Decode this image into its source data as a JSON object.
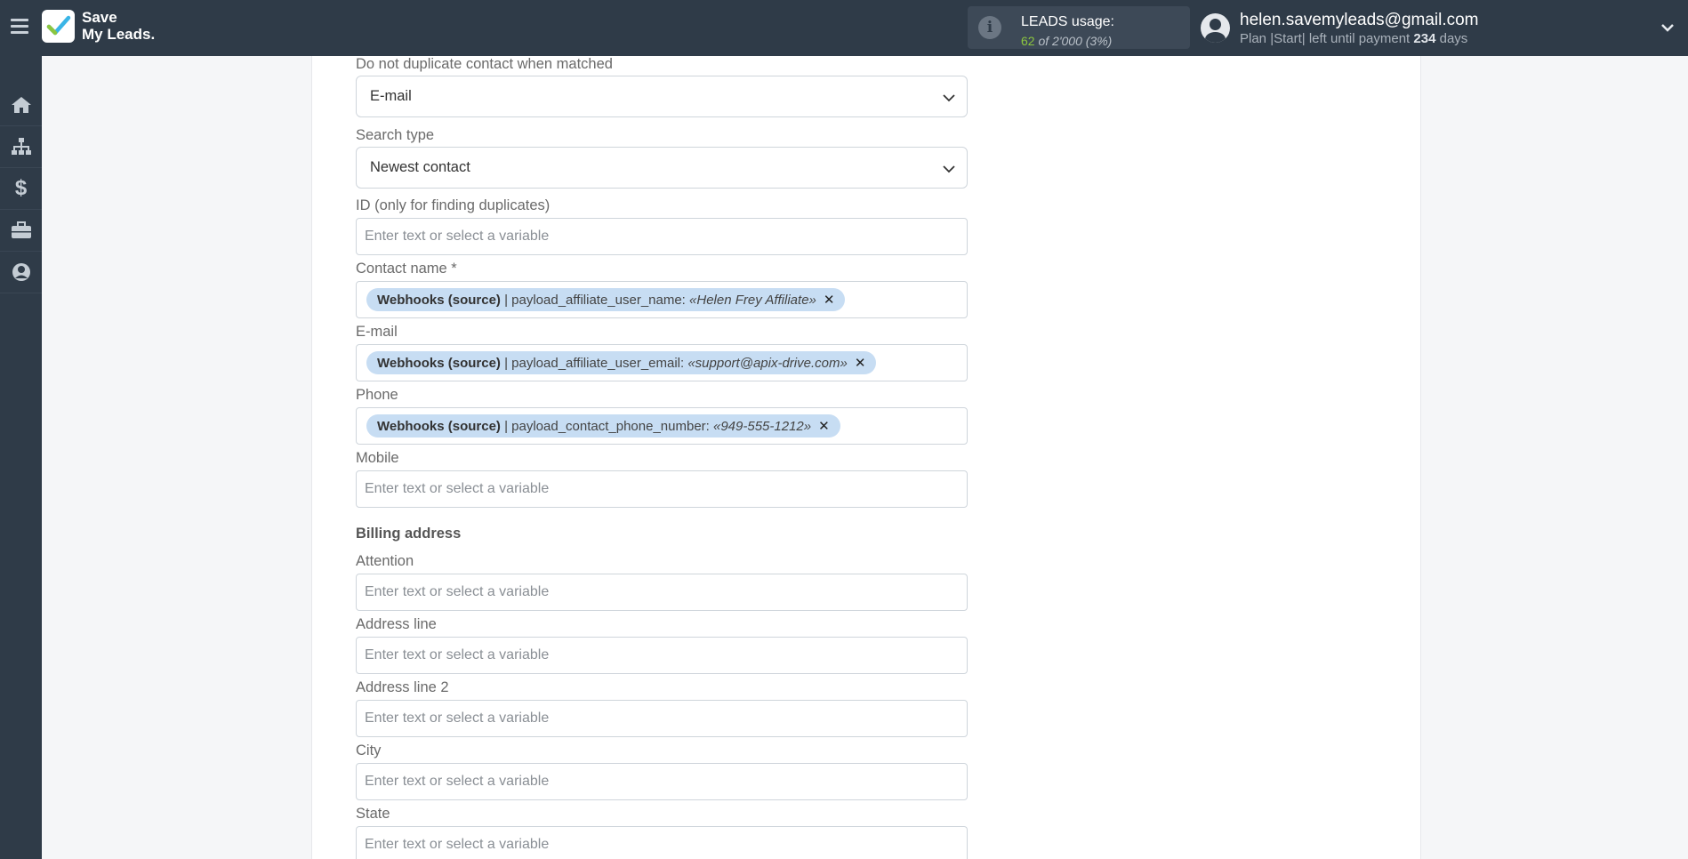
{
  "header": {
    "logo_line1": "Save",
    "logo_line2": "My Leads.",
    "leads_title": "LEADS usage:",
    "leads_used": "62",
    "leads_of": "of 2'000",
    "leads_pct": "(3%)",
    "user_email": "helen.savemyleads@gmail.com",
    "plan_prefix": "Plan |Start| left until payment",
    "plan_days": "234",
    "plan_suffix": "days"
  },
  "sidebar": {
    "items": [
      "home-icon",
      "sitemap-icon",
      "dollar-icon",
      "briefcase-icon",
      "user-icon"
    ]
  },
  "form": {
    "no_duplicate_label": "Do not duplicate contact when matched",
    "no_duplicate_value": "E-mail",
    "search_type_label": "Search type",
    "search_type_value": "Newest contact",
    "id_label": "ID (only for finding duplicates)",
    "placeholder": "Enter text or select a variable",
    "contact_name_label": "Contact name *",
    "contact_name_tag": {
      "source": "Webhooks (source)",
      "field": " | payload_affiliate_user_name: ",
      "value": "«Helen Frey Affiliate»"
    },
    "email_label": "E-mail",
    "email_tag": {
      "source": "Webhooks (source)",
      "field": " | payload_affiliate_user_email: ",
      "value": "«support@apix-drive.com»"
    },
    "phone_label": "Phone",
    "phone_tag": {
      "source": "Webhooks (source)",
      "field": " | payload_contact_phone_number: ",
      "value": "«949-555-1212»"
    },
    "mobile_label": "Mobile",
    "billing_title": "Billing address",
    "attention_label": "Attention",
    "address_line_label": "Address line",
    "address_line2_label": "Address line 2",
    "city_label": "City",
    "state_label": "State"
  },
  "colors": {
    "topbar": "#2f3b48",
    "tag_bg": "#c7ddf3",
    "accent_green": "#8cc63f"
  }
}
